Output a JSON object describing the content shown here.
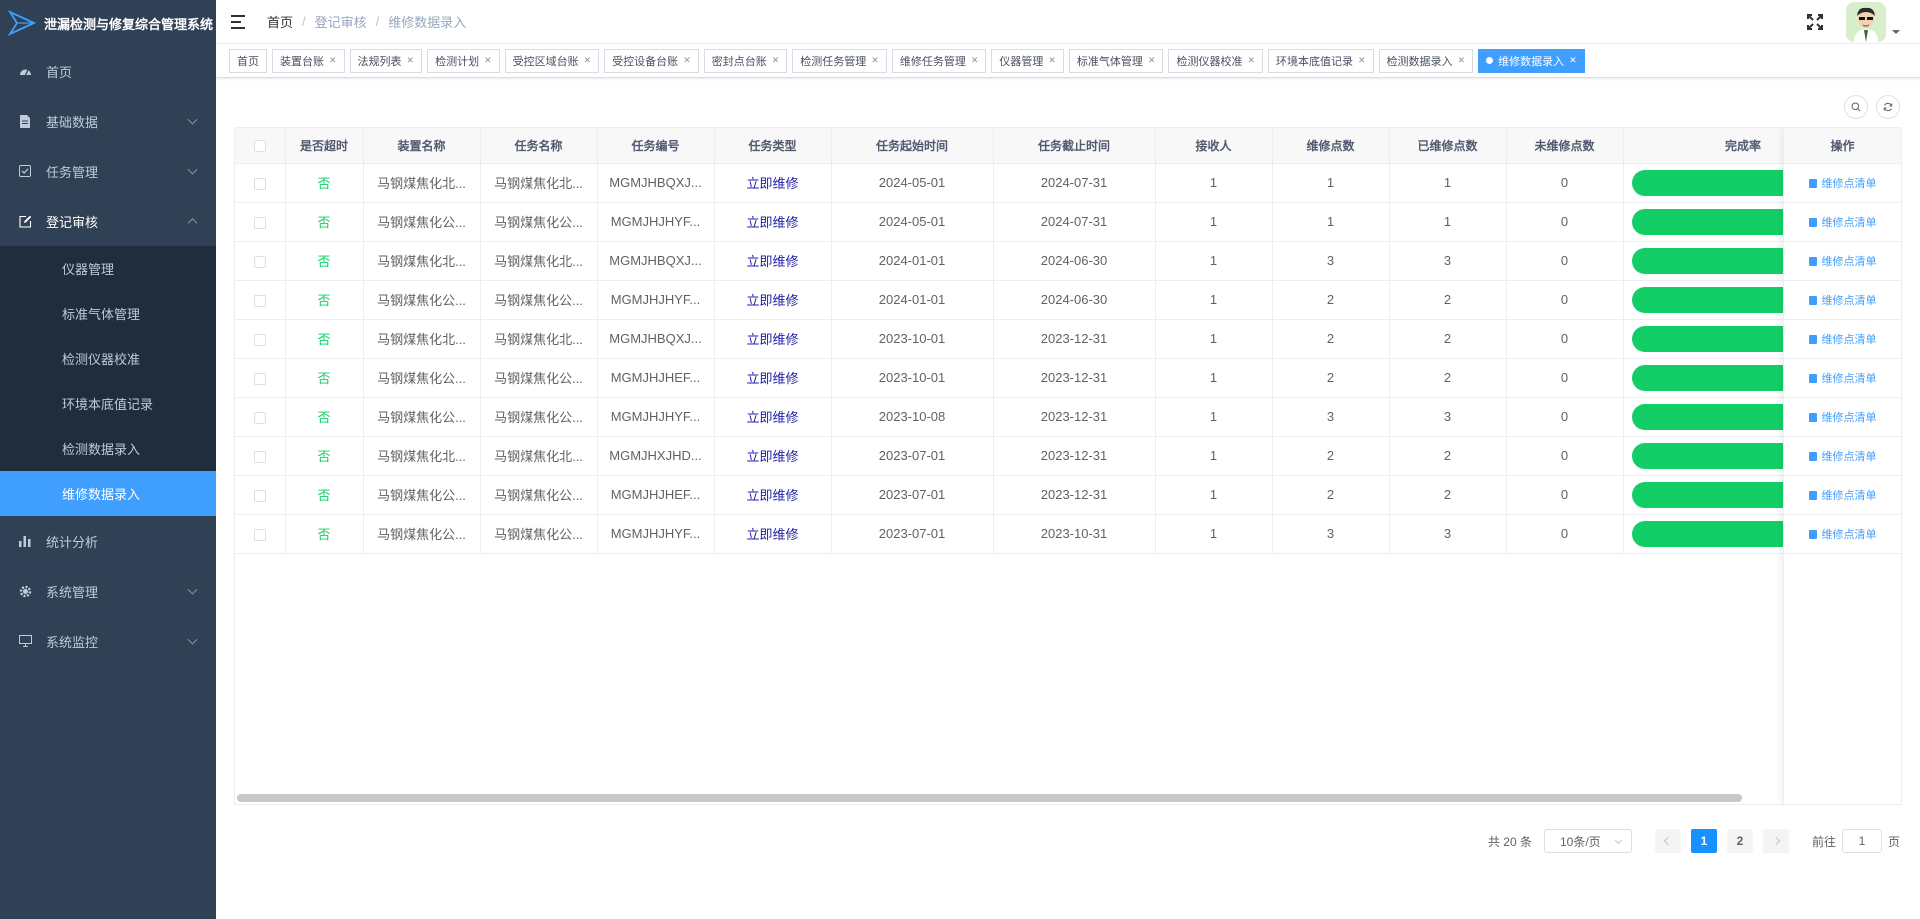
{
  "app": {
    "title": "泄漏检测与修复综合管理系统"
  },
  "sidebar": {
    "items": [
      {
        "label": "首页",
        "icon": "dashboard-icon"
      },
      {
        "label": "基础数据",
        "icon": "document-icon"
      },
      {
        "label": "任务管理",
        "icon": "checklist-icon"
      },
      {
        "label": "登记审核",
        "icon": "edit-icon"
      }
    ],
    "sub_items": [
      {
        "label": "仪器管理"
      },
      {
        "label": "标准气体管理"
      },
      {
        "label": "检测仪器校准"
      },
      {
        "label": "环境本底值记录"
      },
      {
        "label": "检测数据录入"
      },
      {
        "label": "维修数据录入"
      }
    ],
    "bottom_items": [
      {
        "label": "统计分析",
        "icon": "bar-chart-icon"
      },
      {
        "label": "系统管理",
        "icon": "gear-icon"
      },
      {
        "label": "系统监控",
        "icon": "monitor-icon"
      }
    ]
  },
  "breadcrumb": [
    "首页",
    "登记审核",
    "维修数据录入"
  ],
  "tags": [
    "首页",
    "装置台账",
    "法规列表",
    "检测计划",
    "受控区域台账",
    "受控设备台账",
    "密封点台账",
    "检测任务管理",
    "维修任务管理",
    "仪器管理",
    "标准气体管理",
    "检测仪器校准",
    "环境本底值记录",
    "检测数据录入",
    "维修数据录入"
  ],
  "table": {
    "headers": [
      "是否超时",
      "装置名称",
      "任务名称",
      "任务编号",
      "任务类型",
      "任务起始时间",
      "任务截止时间",
      "接收人",
      "维修点数",
      "已维修点数",
      "未维修点数",
      "完成率"
    ],
    "op_header": "操作",
    "op_label": "维修点清单",
    "rows": [
      {
        "overtime": "否",
        "device": "马钢煤焦化北...",
        "task": "马钢煤焦化北...",
        "code": "MGMJHBQXJ...",
        "type": "立即维修",
        "start": "2024-05-01",
        "end": "2024-07-31",
        "receiver": "1",
        "points": "1",
        "repaired": "1",
        "unrepaired": "0",
        "rate": 100
      },
      {
        "overtime": "否",
        "device": "马钢煤焦化公...",
        "task": "马钢煤焦化公...",
        "code": "MGMJHJHYF...",
        "type": "立即维修",
        "start": "2024-05-01",
        "end": "2024-07-31",
        "receiver": "1",
        "points": "1",
        "repaired": "1",
        "unrepaired": "0",
        "rate": 100
      },
      {
        "overtime": "否",
        "device": "马钢煤焦化北...",
        "task": "马钢煤焦化北...",
        "code": "MGMJHBQXJ...",
        "type": "立即维修",
        "start": "2024-01-01",
        "end": "2024-06-30",
        "receiver": "1",
        "points": "3",
        "repaired": "3",
        "unrepaired": "0",
        "rate": 100
      },
      {
        "overtime": "否",
        "device": "马钢煤焦化公...",
        "task": "马钢煤焦化公...",
        "code": "MGMJHJHYF...",
        "type": "立即维修",
        "start": "2024-01-01",
        "end": "2024-06-30",
        "receiver": "1",
        "points": "2",
        "repaired": "2",
        "unrepaired": "0",
        "rate": 100
      },
      {
        "overtime": "否",
        "device": "马钢煤焦化北...",
        "task": "马钢煤焦化北...",
        "code": "MGMJHBQXJ...",
        "type": "立即维修",
        "start": "2023-10-01",
        "end": "2023-12-31",
        "receiver": "1",
        "points": "2",
        "repaired": "2",
        "unrepaired": "0",
        "rate": 100
      },
      {
        "overtime": "否",
        "device": "马钢煤焦化公...",
        "task": "马钢煤焦化公...",
        "code": "MGMJHJHEF...",
        "type": "立即维修",
        "start": "2023-10-01",
        "end": "2023-12-31",
        "receiver": "1",
        "points": "2",
        "repaired": "2",
        "unrepaired": "0",
        "rate": 100
      },
      {
        "overtime": "否",
        "device": "马钢煤焦化公...",
        "task": "马钢煤焦化公...",
        "code": "MGMJHJHYF...",
        "type": "立即维修",
        "start": "2023-10-08",
        "end": "2023-12-31",
        "receiver": "1",
        "points": "3",
        "repaired": "3",
        "unrepaired": "0",
        "rate": 100
      },
      {
        "overtime": "否",
        "device": "马钢煤焦化北...",
        "task": "马钢煤焦化北...",
        "code": "MGMJHXJHD...",
        "type": "立即维修",
        "start": "2023-07-01",
        "end": "2023-12-31",
        "receiver": "1",
        "points": "2",
        "repaired": "2",
        "unrepaired": "0",
        "rate": 100
      },
      {
        "overtime": "否",
        "device": "马钢煤焦化公...",
        "task": "马钢煤焦化公...",
        "code": "MGMJHJHEF...",
        "type": "立即维修",
        "start": "2023-07-01",
        "end": "2023-12-31",
        "receiver": "1",
        "points": "2",
        "repaired": "2",
        "unrepaired": "0",
        "rate": 100
      },
      {
        "overtime": "否",
        "device": "马钢煤焦化公...",
        "task": "马钢煤焦化公...",
        "code": "MGMJHJHYF...",
        "type": "立即维修",
        "start": "2023-07-01",
        "end": "2023-10-31",
        "receiver": "1",
        "points": "3",
        "repaired": "3",
        "unrepaired": "0",
        "rate": 100
      }
    ]
  },
  "pagination": {
    "total": "共 20 条",
    "page_size": "10条/页",
    "pages": [
      "1",
      "2"
    ],
    "current": "1",
    "goto_label": "前往",
    "goto_value": "1",
    "goto_suffix": "页"
  },
  "colors": {
    "sidebar_bg": "#304156",
    "submenu_bg": "#1f2d3d",
    "accent": "#409eff",
    "progress": "#13ce66"
  }
}
